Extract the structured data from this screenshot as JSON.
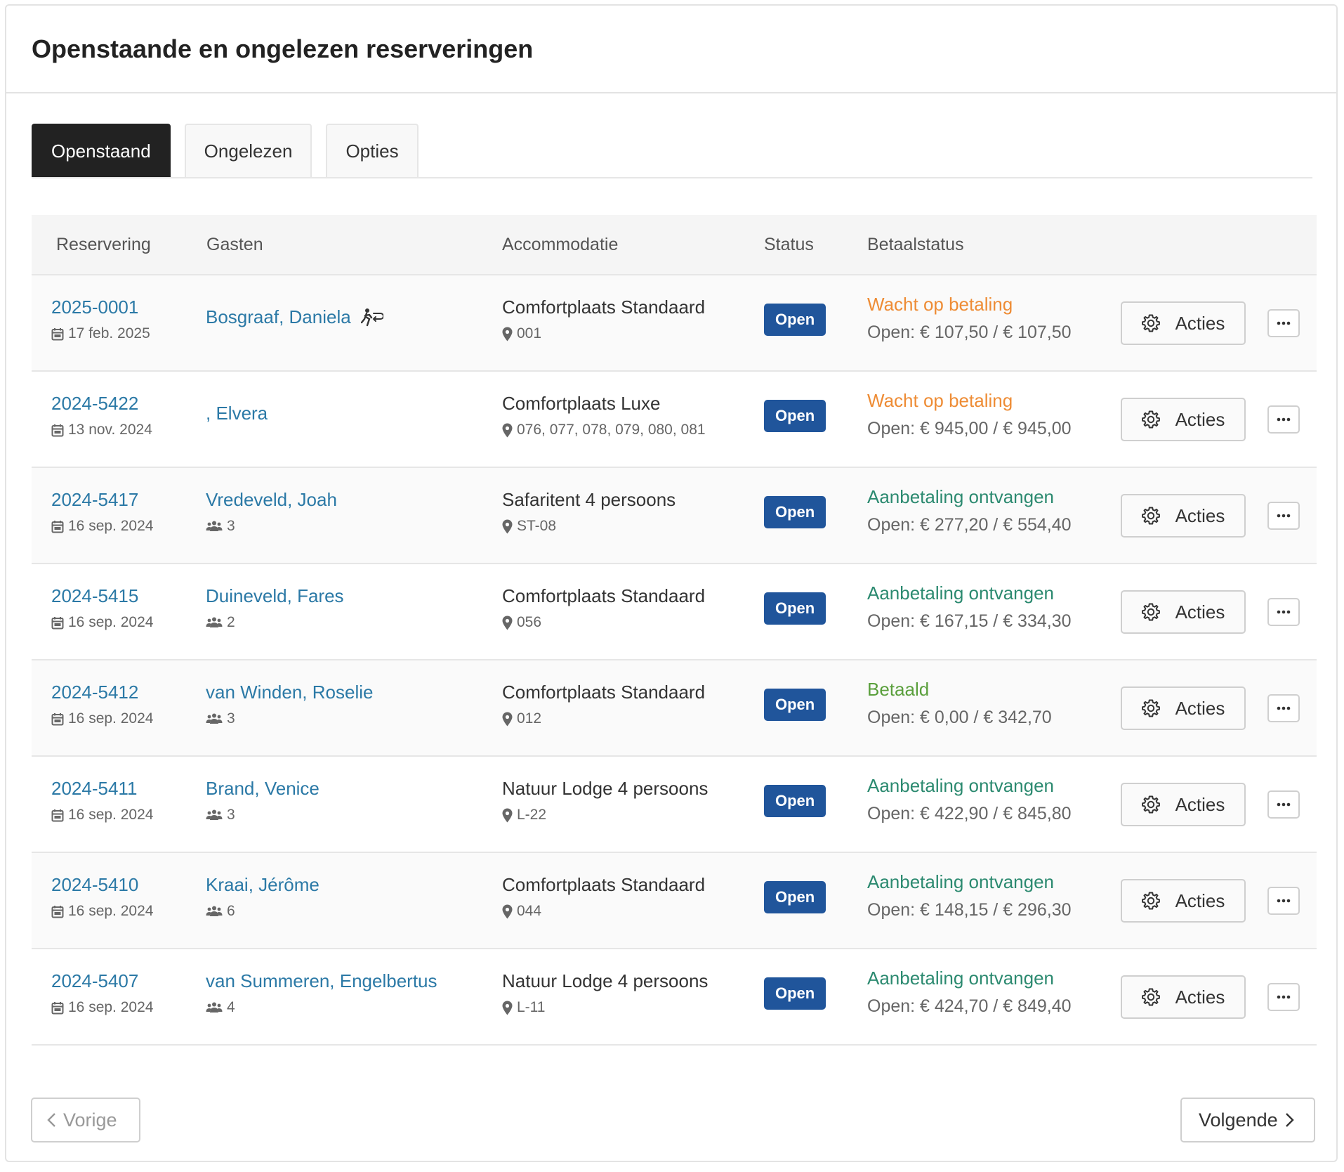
{
  "page": {
    "title": "Openstaande en ongelezen reserveringen"
  },
  "tabs": [
    {
      "label": "Openstaand",
      "active": true
    },
    {
      "label": "Ongelezen",
      "active": false
    },
    {
      "label": "Opties",
      "active": false
    }
  ],
  "table": {
    "headers": {
      "reservation": "Reservering",
      "guests": "Gasten",
      "accommodation": "Accommodatie",
      "status": "Status",
      "payment": "Betaalstatus"
    },
    "rows": [
      {
        "id": "2025-0001",
        "date": "17 feb. 2025",
        "guest": "Bosgraaf, Daniela",
        "guest_icon": "walk-in-icon",
        "guest_count": null,
        "accommodation": "Comfortplaats Standaard",
        "location": "001",
        "status": "Open",
        "payment_status": "Wacht op betaling",
        "payment_color": "orange",
        "payment_open": "Open: € 107,50 / € 107,50",
        "actions_label": "Acties"
      },
      {
        "id": "2024-5422",
        "date": "13 nov. 2024",
        "guest": ", Elvera",
        "guest_icon": null,
        "guest_count": null,
        "accommodation": "Comfortplaats Luxe",
        "location": "076, 077, 078, 079, 080, 081",
        "status": "Open",
        "payment_status": "Wacht op betaling",
        "payment_color": "orange",
        "payment_open": "Open: € 945,00 / € 945,00",
        "actions_label": "Acties"
      },
      {
        "id": "2024-5417",
        "date": "16 sep. 2024",
        "guest": "Vredeveld, Joah",
        "guest_icon": null,
        "guest_count": "3",
        "accommodation": "Safaritent 4 persoons",
        "location": "ST-08",
        "status": "Open",
        "payment_status": "Aanbetaling ontvangen",
        "payment_color": "teal",
        "payment_open": "Open: € 277,20 / € 554,40",
        "actions_label": "Acties"
      },
      {
        "id": "2024-5415",
        "date": "16 sep. 2024",
        "guest": "Duineveld, Fares",
        "guest_icon": null,
        "guest_count": "2",
        "accommodation": "Comfortplaats Standaard",
        "location": "056",
        "status": "Open",
        "payment_status": "Aanbetaling ontvangen",
        "payment_color": "teal",
        "payment_open": "Open: € 167,15 / € 334,30",
        "actions_label": "Acties"
      },
      {
        "id": "2024-5412",
        "date": "16 sep. 2024",
        "guest": "van Winden, Roselie",
        "guest_icon": null,
        "guest_count": "3",
        "accommodation": "Comfortplaats Standaard",
        "location": "012",
        "status": "Open",
        "payment_status": "Betaald",
        "payment_color": "green",
        "payment_open": "Open: € 0,00 / € 342,70",
        "actions_label": "Acties"
      },
      {
        "id": "2024-5411",
        "date": "16 sep. 2024",
        "guest": "Brand, Venice",
        "guest_icon": null,
        "guest_count": "3",
        "accommodation": "Natuur Lodge 4 persoons",
        "location": "L-22",
        "status": "Open",
        "payment_status": "Aanbetaling ontvangen",
        "payment_color": "teal",
        "payment_open": "Open: € 422,90 / € 845,80",
        "actions_label": "Acties"
      },
      {
        "id": "2024-5410",
        "date": "16 sep. 2024",
        "guest": "Kraai, Jérôme",
        "guest_icon": null,
        "guest_count": "6",
        "accommodation": "Comfortplaats Standaard",
        "location": "044",
        "status": "Open",
        "payment_status": "Aanbetaling ontvangen",
        "payment_color": "teal",
        "payment_open": "Open: € 148,15 / € 296,30",
        "actions_label": "Acties"
      },
      {
        "id": "2024-5407",
        "date": "16 sep. 2024",
        "guest": "van Summeren, Engelbertus",
        "guest_icon": null,
        "guest_count": "4",
        "accommodation": "Natuur Lodge 4 persoons",
        "location": "L-11",
        "status": "Open",
        "payment_status": "Aanbetaling ontvangen",
        "payment_color": "teal",
        "payment_open": "Open: € 424,70 / € 849,40",
        "actions_label": "Acties"
      }
    ]
  },
  "pagination": {
    "prev_label": "Vorige",
    "next_label": "Volgende",
    "prev_enabled": false,
    "next_enabled": true
  },
  "colors": {
    "link": "#2b79a6",
    "badge": "#20559b",
    "orange": "#ee8c35",
    "teal": "#2c8a70",
    "green": "#5a9f3c"
  }
}
